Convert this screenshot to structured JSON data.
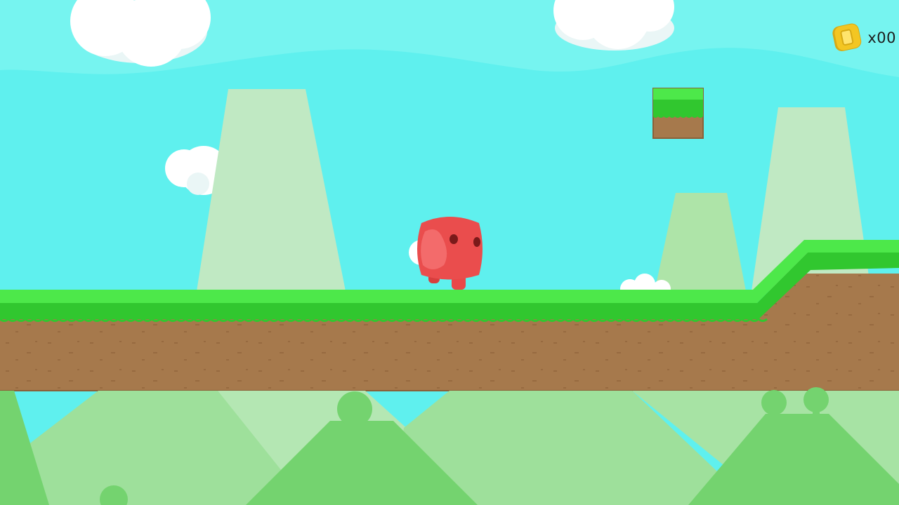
{
  "hud": {
    "coin_count": "x00",
    "coin_icon": "coin-icon"
  },
  "colors": {
    "sky": "#5ff0ee",
    "sky_band": "#7af6f2",
    "grass_light": "#4de84a",
    "grass_dark": "#31c72f",
    "dirt": "#a6794c",
    "dirt_edge": "#8a6038",
    "player": "#ea4d4d",
    "player_highlight": "#f46f6f",
    "player_eye": "#7a1a1a",
    "mountain_far": "#c0e9c3",
    "mountain_mid": "#aee4a8",
    "hill_light": "#9ee09b",
    "hill_dark": "#74d36f",
    "cloud": "#ffffff",
    "coin": "#f3c622"
  }
}
